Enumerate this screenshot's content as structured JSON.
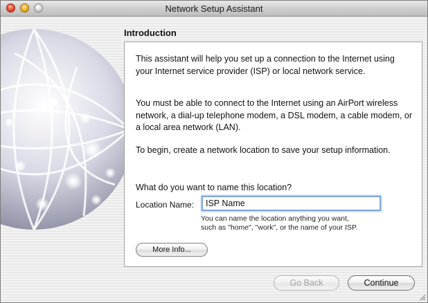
{
  "window": {
    "title": "Network Setup Assistant"
  },
  "section": {
    "title": "Introduction"
  },
  "content": {
    "paragraph1": "This assistant will help you set up a connection to the Internet using your Internet service provider (ISP) or local network service.",
    "paragraph2": "You must be able to connect to the Internet using an AirPort wireless network, a dial-up telephone modem, a DSL modem, a cable modem, or a local area network (LAN).",
    "paragraph3": "To begin, create a network location to save your setup information.",
    "question": "What do you want to name this location?",
    "location_label": "Location Name:",
    "location_value": "ISP Name",
    "hint_line1": "You can name the location anything you want,",
    "hint_line2": "such as \"home\", \"work\", or the name of your ISP.",
    "more_info_label": "More Info..."
  },
  "footer": {
    "go_back_label": "Go Back",
    "go_back_enabled": false,
    "continue_label": "Continue"
  },
  "icons": {
    "close": "close-icon",
    "minimize": "minimize-icon",
    "zoom": "zoom-icon",
    "globe": "network-globe-icon",
    "resize": "resize-grip-icon"
  },
  "colors": {
    "focus_ring": "#7ea6de",
    "close_button": "#f0533a",
    "minimize_button": "#f6b92a",
    "disabled_text": "#a3a3a3"
  }
}
